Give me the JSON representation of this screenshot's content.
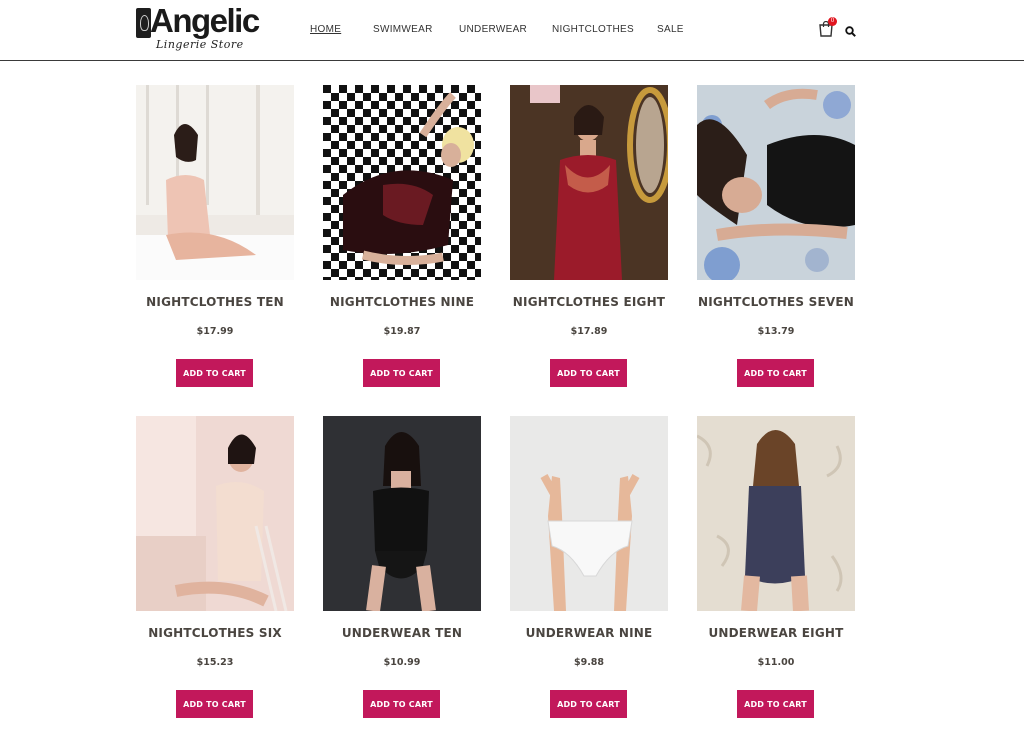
{
  "brand": {
    "name": "Angelic",
    "tagline": "Lingerie Store"
  },
  "nav": {
    "items": [
      "HOME",
      "SWIMWEAR",
      "UNDERWEAR",
      "NIGHTCLOTHES",
      "SALE"
    ]
  },
  "cart": {
    "count": "0",
    "icon": "cart-icon"
  },
  "search": {
    "icon": "search-icon"
  },
  "colors": {
    "accent": "#c2185b",
    "text": "#4a4540",
    "badge": "#e1151f"
  },
  "products": [
    {
      "name": "NIGHTCLOTHES TEN",
      "price": "$17.99",
      "button": "ADD TO CART"
    },
    {
      "name": "NIGHTCLOTHES NINE",
      "price": "$19.87",
      "button": "ADD TO CART"
    },
    {
      "name": "NIGHTCLOTHES EIGHT",
      "price": "$17.89",
      "button": "ADD TO CART"
    },
    {
      "name": "NIGHTCLOTHES SEVEN",
      "price": "$13.79",
      "button": "ADD TO CART"
    },
    {
      "name": "NIGHTCLOTHES SIX",
      "price": "$15.23",
      "button": "ADD TO CART"
    },
    {
      "name": "UNDERWEAR TEN",
      "price": "$10.99",
      "button": "ADD TO CART"
    },
    {
      "name": "UNDERWEAR NINE",
      "price": "$9.88",
      "button": "ADD TO CART"
    },
    {
      "name": "UNDERWEAR EIGHT",
      "price": "$11.00",
      "button": "ADD TO CART"
    }
  ]
}
